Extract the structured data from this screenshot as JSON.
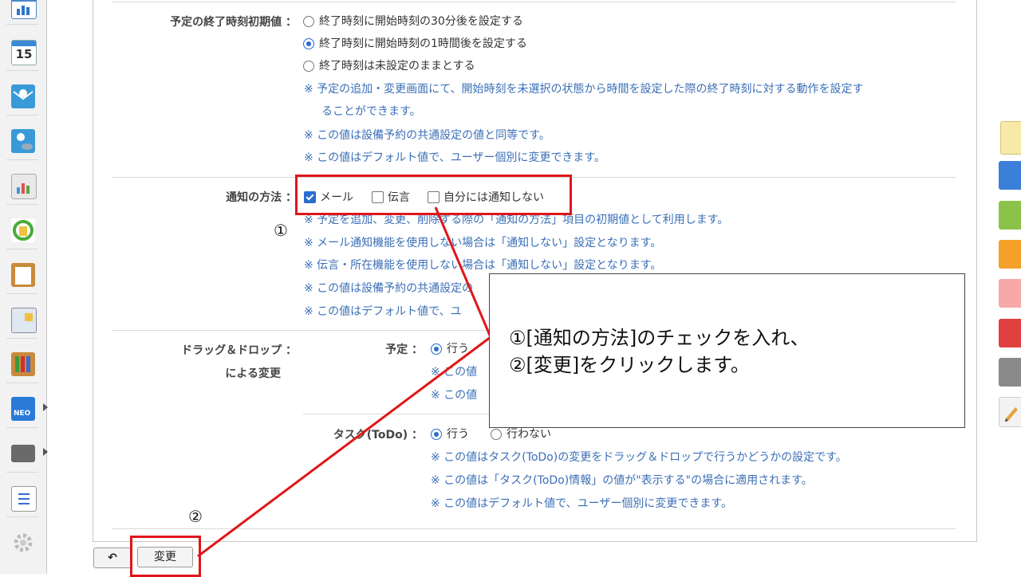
{
  "end_time_setting": {
    "label": "予定の終了時刻初期値 ：",
    "options": [
      {
        "text": "終了時刻に開始時刻の30分後を設定する",
        "selected": false
      },
      {
        "text": "終了時刻に開始時刻の1時間後を設定する",
        "selected": true
      },
      {
        "text": "終了時刻は未設定のままとする",
        "selected": false
      }
    ],
    "notes": [
      "※ 予定の追加・変更画面にて、開始時刻を未選択の状態から時間を設定した際の終了時刻に対する動作を設定す",
      "ることができます。",
      "※ この値は設備予約の共通設定の値と同等です。",
      "※ この値はデフォルト値で、ユーザー個別に変更できます。"
    ]
  },
  "notify_method": {
    "label": "通知の方法 ：",
    "options": [
      {
        "text": "メール",
        "checked": true
      },
      {
        "text": "伝言",
        "checked": false
      },
      {
        "text": "自分には通知しない",
        "checked": false
      }
    ],
    "notes": [
      "※ 予定を追加、変更、削除する際の「通知の方法」項目の初期値として利用します。",
      "※ メール通知機能を使用しない場合は「通知しない」設定となります。",
      "※ 伝言・所在機能を使用しない場合は「通知しない」設定となります。",
      "※ この値は設備予約の共通設定の",
      "※ この値はデフォルト値で、ユ"
    ]
  },
  "drag_drop": {
    "label_line1": "ドラッグ＆ドロップ ：",
    "label_line2": "による変更",
    "schedule": {
      "label": "予定 ：",
      "option_do": "行う",
      "notes": [
        "※ この値",
        "※ この値"
      ]
    },
    "task": {
      "label": "タスク(ToDo) ：",
      "option_do": "行う",
      "option_dont": "行わない",
      "notes": [
        "※ この値はタスク(ToDo)の変更をドラッグ＆ドロップで行うかどうかの設定です。",
        "※ この値は「タスク(ToDo)情報」の値が\"表示する\"の場合に適用されます。",
        "※ この値はデフォルト値で、ユーザー個別に変更できます。"
      ]
    }
  },
  "buttons": {
    "back_icon": "↶",
    "change": "変更"
  },
  "annotation": {
    "marker1": "①",
    "marker2": "②",
    "callout_line1": "①[通知の方法]のチェックを入れ、",
    "callout_line2": "②[変更]をクリックします。"
  },
  "sidebar": {
    "icons": [
      "chart-icon",
      "calendar-icon",
      "mail-icon",
      "mail-database-icon",
      "report-icon",
      "sync-icon",
      "clipboard-icon",
      "bulletin-icon",
      "binder-icon",
      "neo-icon",
      "folder-icon",
      "list-icon",
      "gear-icon"
    ],
    "calendar_day": "15",
    "neo_label": "NEO"
  },
  "colors": {
    "accent": "#2a6ccf",
    "note": "#3b6fb6",
    "annotation_red": "#e0161b"
  }
}
